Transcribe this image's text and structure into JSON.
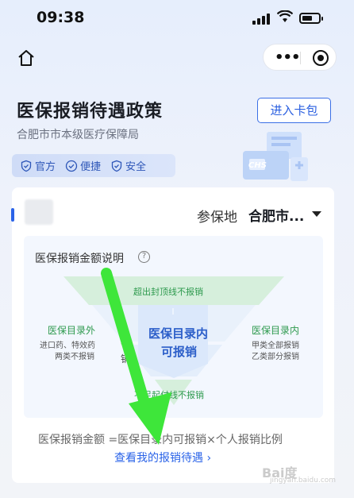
{
  "status_bar": {
    "time": "09:38"
  },
  "nav": {
    "home_icon": "home-icon",
    "more_icon": "more-dots-icon",
    "close_icon": "target-icon"
  },
  "header": {
    "title": "医保报销待遇政策",
    "subtitle": "合肥市市本级医疗保障局",
    "card_button": "进入卡包",
    "badges": [
      {
        "icon": "shield-check-icon",
        "label": "官方"
      },
      {
        "icon": "check-circle-icon",
        "label": "便捷"
      },
      {
        "icon": "shield-check-icon",
        "label": "安全"
      }
    ],
    "art_text": "CHS"
  },
  "card": {
    "region_label": "参保地",
    "region_value": "合肥市...",
    "explain_title": "医保报销金额说明",
    "diagram": {
      "top_band": "超出封顶线不报销",
      "left_title": "医保目录外",
      "left_sub1": "进口药、特效药",
      "left_sub2": "两类不报销",
      "right_title": "医保目录内",
      "right_sub1": "甲类全部报销",
      "right_sub2": "乙类部分报销",
      "center_title": "医保目录内",
      "center_sub": "可报销",
      "side_a": "报",
      "side_b": "销",
      "bottom_band": "不足起付线不报销"
    },
    "formula": "医保报销金额 =医保目录内可报销×个人报销比例",
    "view_link": "查看我的报销待遇 ›"
  },
  "watermark": {
    "text": "Bai度",
    "sub": "jingyan.baidu.com"
  },
  "colors": {
    "accent": "#2a63e8",
    "green": "#2e9a4e",
    "arrow": "#3ee63a"
  }
}
